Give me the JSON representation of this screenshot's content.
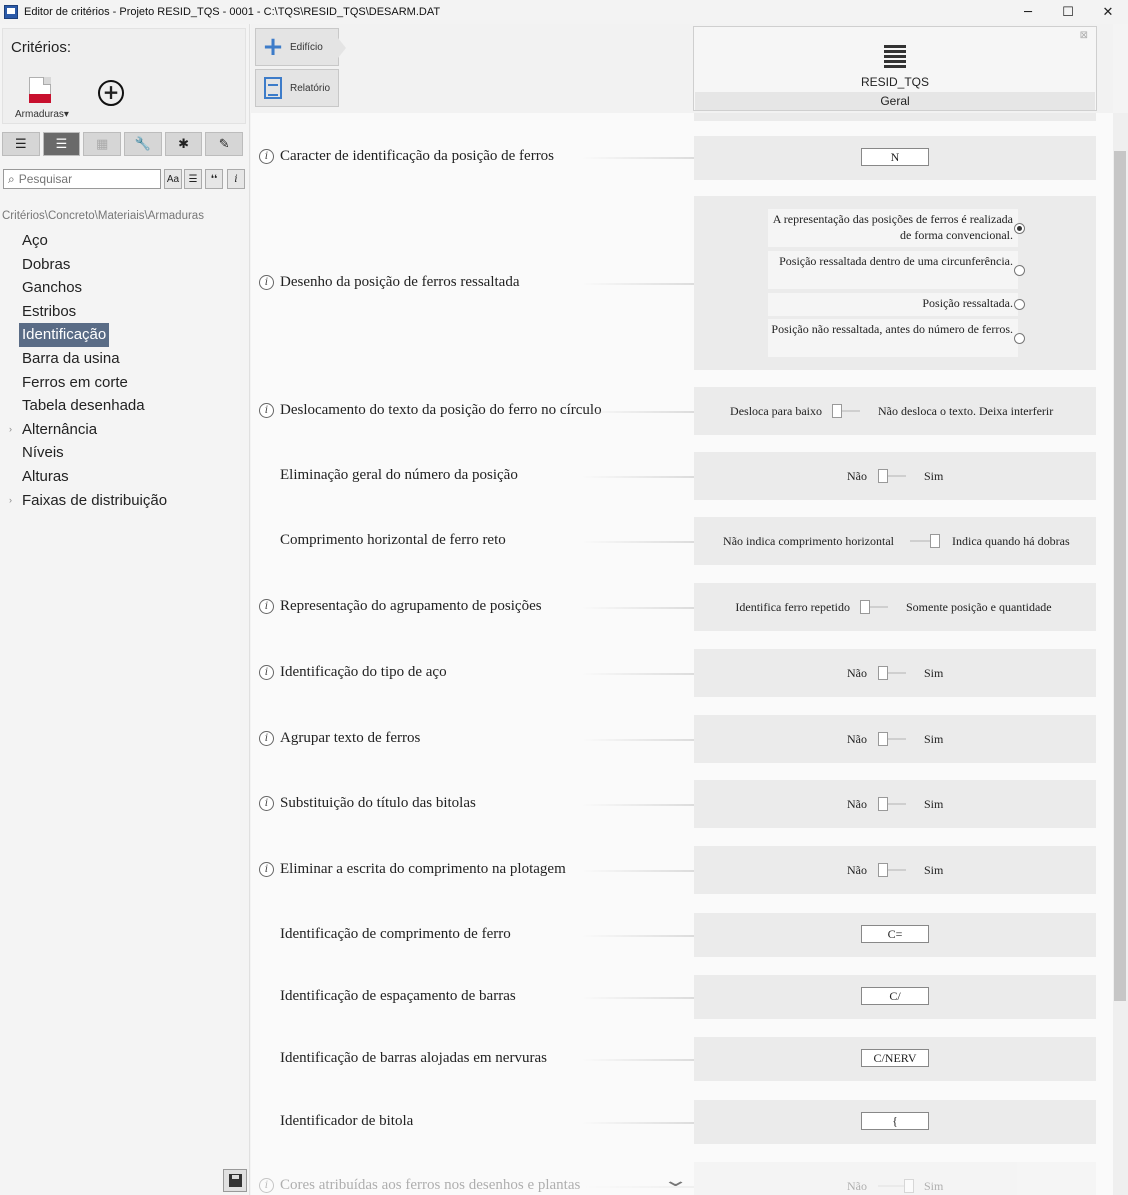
{
  "window": {
    "title": "Editor de critérios - Projeto RESID_TQS - 0001 - C:\\TQS\\RESID_TQS\\DESARM.DAT",
    "minimize": "─",
    "maximize": "☐",
    "close": "✕"
  },
  "sidebar": {
    "title": "Critérios:",
    "armaduras_label": "Armaduras",
    "toolbar_icons": [
      "list-icon",
      "align-center-icon",
      "grid-icon",
      "wrench-icon",
      "asterisk-icon",
      "pencil-icon"
    ],
    "search_placeholder": "Pesquisar",
    "search_buttons": [
      "Aa",
      "☰",
      "❛❛",
      "i"
    ],
    "breadcrumb": "Critérios\\Concreto\\Materiais\\Armaduras",
    "items": [
      {
        "label": "Aço"
      },
      {
        "label": "Dobras"
      },
      {
        "label": "Ganchos"
      },
      {
        "label": "Estribos"
      },
      {
        "label": "Identificação"
      },
      {
        "label": "Barra da usina"
      },
      {
        "label": "Ferros em corte"
      },
      {
        "label": "Tabela desenhada"
      },
      {
        "label": "Alternância"
      },
      {
        "label": "Níveis"
      },
      {
        "label": "Alturas"
      },
      {
        "label": "Faixas de distribuição"
      }
    ],
    "selected_item": "Identificação"
  },
  "ribbon": {
    "edificio_label": "Edifício",
    "relatorio_label": "Relatório"
  },
  "header_card": {
    "name": "RESID_TQS",
    "tab": "Geral"
  },
  "rows": {
    "r1": {
      "label": "Caracter de identificação da posição de ferros",
      "value": "N"
    },
    "r2": {
      "label": "Desenho da posição de ferros ressaltada",
      "options": [
        "A representação das posições de ferros é realizada de forma convencional.",
        "Posição ressaltada dentro de uma circunferência.",
        "Posição ressaltada.",
        "Posição não ressaltada, antes do número de ferros."
      ]
    },
    "r3": {
      "label": "Deslocamento do texto da posição do ferro no círculo",
      "left": "Desloca para baixo",
      "right": "Não desloca o texto. Deixa interferir"
    },
    "r4": {
      "label": "Eliminação geral do número da posição",
      "left": "Não",
      "right": "Sim"
    },
    "r5": {
      "label": "Comprimento horizontal de ferro reto",
      "left": "Não indica comprimento horizontal",
      "right": "Indica quando há dobras"
    },
    "r6": {
      "label": "Representação do agrupamento de posições",
      "left": "Identifica ferro repetido",
      "right": "Somente posição e quantidade"
    },
    "r7": {
      "label": "Identificação do tipo de aço",
      "left": "Não",
      "right": "Sim"
    },
    "r8": {
      "label": "Agrupar texto de ferros",
      "left": "Não",
      "right": "Sim"
    },
    "r9": {
      "label": "Substituição do título das bitolas",
      "left": "Não",
      "right": "Sim"
    },
    "r10": {
      "label": "Eliminar a escrita do comprimento na plotagem",
      "left": "Não",
      "right": "Sim"
    },
    "r11": {
      "label": "Identificação de comprimento de ferro",
      "value": "C="
    },
    "r12": {
      "label": "Identificação de espaçamento de barras",
      "value": "C/"
    },
    "r13": {
      "label": "Identificação de barras alojadas em nervuras",
      "value": "C/NERV"
    },
    "r14": {
      "label": "Identificador de bitola",
      "value": "{"
    },
    "r15": {
      "label": "Cores atribuídas aos ferros nos desenhos e plantas",
      "left": "Não",
      "right": "Sim"
    }
  }
}
